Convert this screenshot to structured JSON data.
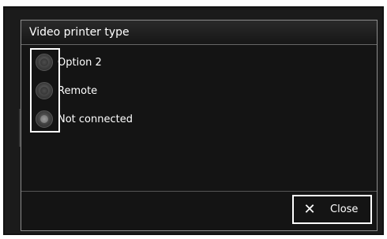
{
  "dialog": {
    "title": "Video printer type",
    "options": [
      {
        "label": "Option 2",
        "selected": false
      },
      {
        "label": "Remote",
        "selected": false
      },
      {
        "label": "Not connected",
        "selected": true
      }
    ],
    "close_label": "Close",
    "close_icon": "close-icon"
  }
}
